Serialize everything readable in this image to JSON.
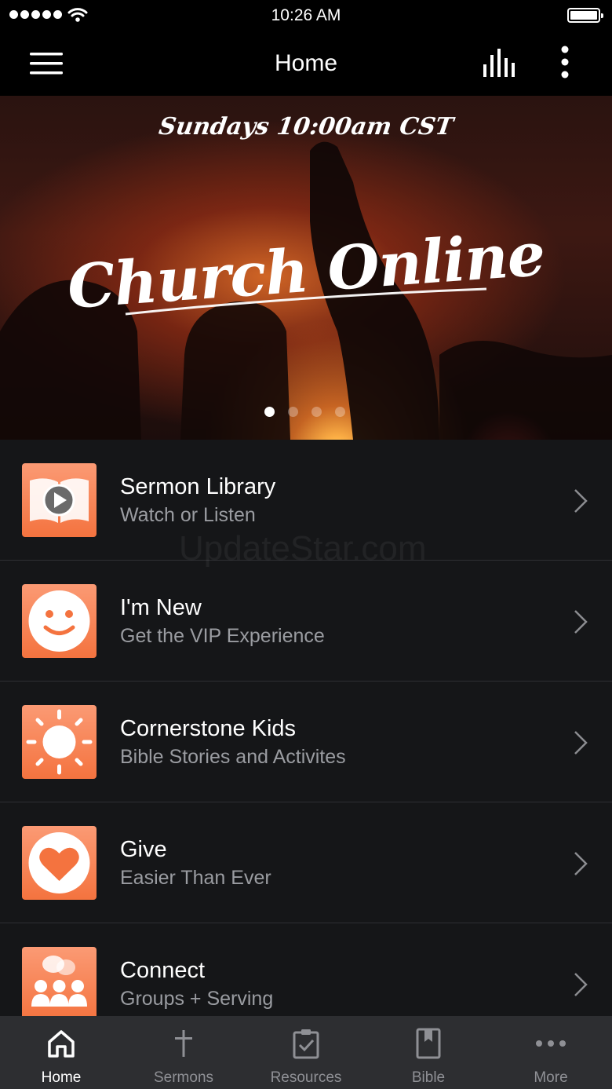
{
  "status_bar": {
    "time": "10:26 AM"
  },
  "nav": {
    "title": "Home"
  },
  "hero": {
    "subtitle": "Sundays 10:00am CST",
    "title": "Church Online",
    "slide_count": 4,
    "active_slide": 1
  },
  "items": [
    {
      "title": "Sermon Library",
      "subtitle": "Watch or Listen",
      "icon": "book-play-icon"
    },
    {
      "title": "I'm New",
      "subtitle": "Get the VIP Experience",
      "icon": "smiley-icon"
    },
    {
      "title": "Cornerstone Kids",
      "subtitle": "Bible Stories and Activites",
      "icon": "sun-icon"
    },
    {
      "title": "Give",
      "subtitle": "Easier Than Ever",
      "icon": "heart-icon"
    },
    {
      "title": "Connect",
      "subtitle": "Groups + Serving",
      "icon": "people-chat-icon"
    }
  ],
  "watermark": "UpdateStar.com",
  "tabs": [
    {
      "label": "Home",
      "icon": "home-icon",
      "active": true
    },
    {
      "label": "Sermons",
      "icon": "cross-icon",
      "active": false
    },
    {
      "label": "Resources",
      "icon": "clipboard-check-icon",
      "active": false
    },
    {
      "label": "Bible",
      "icon": "bible-icon",
      "active": false
    },
    {
      "label": "More",
      "icon": "more-dots-icon",
      "active": false
    }
  ],
  "colors": {
    "accent": "#f4733f",
    "accent_light": "#fb9a74",
    "background": "#151618",
    "tab_bar": "#2d2e31",
    "subtitle_gray": "#9a9ca1"
  }
}
